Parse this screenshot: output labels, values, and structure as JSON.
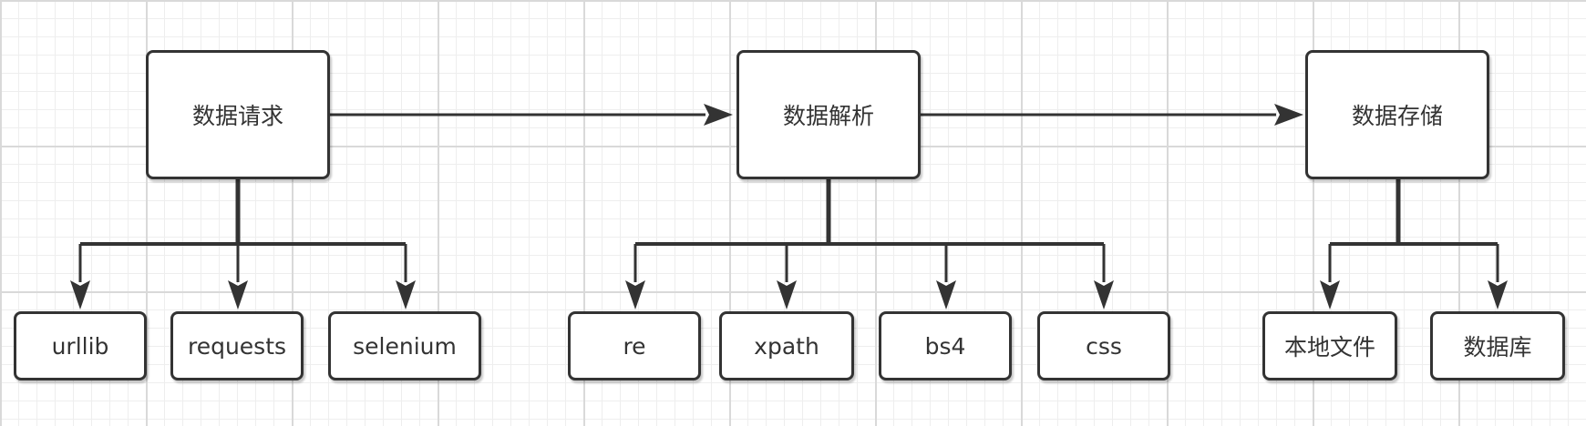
{
  "colors": {
    "stroke": "#333333",
    "fill": "#ffffff",
    "text": "#333333"
  },
  "stages": [
    {
      "label": "数据请求",
      "children": [
        "urllib",
        "requests",
        "selenium"
      ]
    },
    {
      "label": "数据解析",
      "children": [
        "re",
        "xpath",
        "bs4",
        "css"
      ]
    },
    {
      "label": "数据存储",
      "children": [
        "本地文件",
        "数据库"
      ]
    }
  ]
}
